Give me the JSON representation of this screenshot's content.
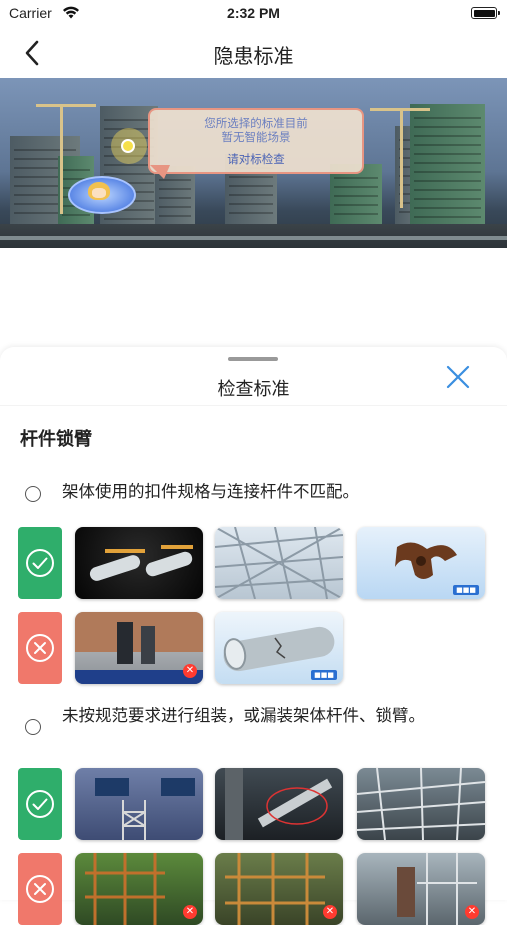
{
  "status": {
    "carrier": "Carrier",
    "time": "2:32 PM"
  },
  "nav": {
    "title": "隐患标准"
  },
  "scene": {
    "bubble_line1": "您所选择的标准目前",
    "bubble_line2": "暂无智能场景",
    "bubble_link": "请对标检查"
  },
  "sheet": {
    "title": "检查标准",
    "section_title": "杆件锁臂",
    "options": [
      {
        "text": "架体使用的扣件规格与连接杆件不匹配。",
        "selected": false
      },
      {
        "text": "未按规范要求进行组装，或漏装架体杆件、锁臂。",
        "selected": false
      }
    ],
    "correct_label_icon": "check-circle-icon",
    "wrong_label_icon": "x-circle-icon"
  },
  "colors": {
    "correct": "#2fae6b",
    "wrong": "#f0786b",
    "close": "#3b8fe0"
  }
}
